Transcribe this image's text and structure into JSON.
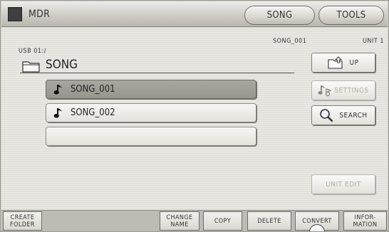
{
  "titlebar": {
    "app_label": "MDR",
    "tabs": [
      {
        "label": "SONG"
      },
      {
        "label": "TOOLS"
      }
    ]
  },
  "location": {
    "path": "USB 01:/",
    "current_file": "SONG_001",
    "unit": "UNIT 1",
    "folder_name": "SONG"
  },
  "files": [
    {
      "name": "SONG_001",
      "selected": true
    },
    {
      "name": "SONG_002",
      "selected": false
    },
    {
      "name": "",
      "selected": false
    }
  ],
  "side_buttons": {
    "up": "UP",
    "settings": "SETTINGS",
    "search": "SEARCH",
    "unit_edit": "UNIT EDIT"
  },
  "bottom_buttons": {
    "create_folder": "CREATE\nFOLDER",
    "change_name": "CHANGE\nNAME",
    "copy": "COPY",
    "delete": "DELETE",
    "convert": "CONVERT",
    "information": "INFOR-\nMATION"
  },
  "icons": {
    "folder": "folder-icon",
    "note": "music-note-icon",
    "up": "folder-up-icon",
    "settings": "settings-notes-icon",
    "search": "magnifier-icon"
  }
}
